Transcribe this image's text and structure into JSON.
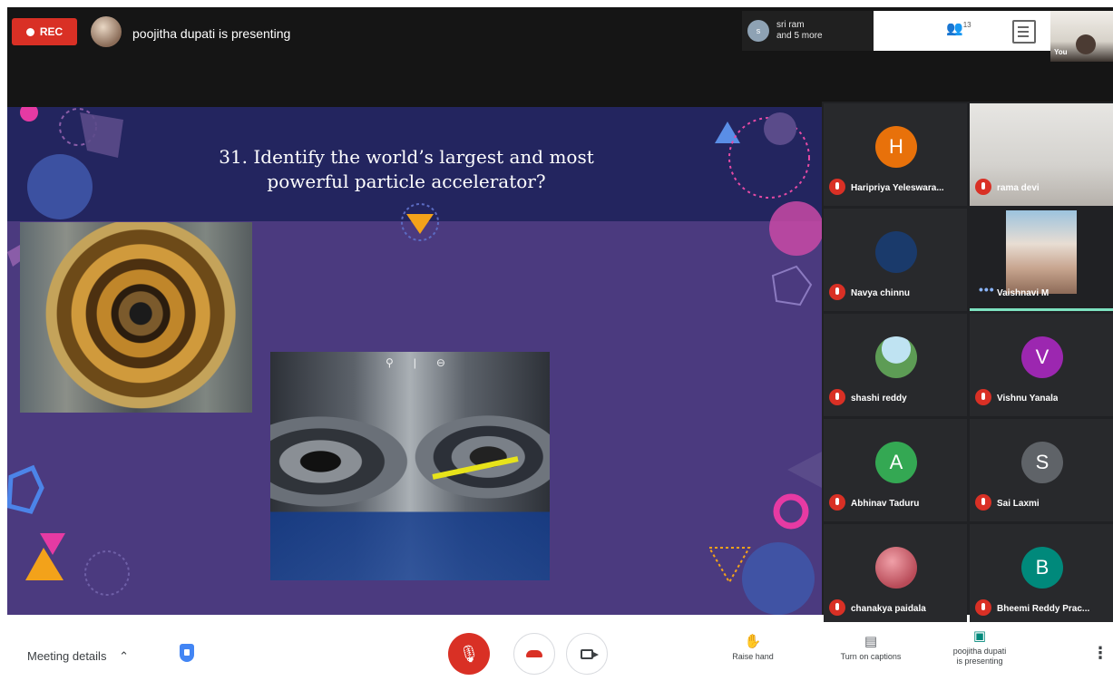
{
  "topbar": {
    "rec_label": "REC",
    "presenting_text": "poojitha dupati is presenting",
    "speaker_initial": "s",
    "speaker_line1": "sri ram",
    "speaker_line2": "and 5 more",
    "people_count": "13",
    "self_label": "You"
  },
  "slide": {
    "question": "31. Identify the world’s largest and most powerful particle accelerator?"
  },
  "participants": [
    {
      "name": "Haripriya Yeleswara...",
      "initial": "H",
      "color": "#e8710a"
    },
    {
      "name": "rama devi",
      "initial": "",
      "color": ""
    },
    {
      "name": "Navya chinnu",
      "initial": "",
      "color": "#1a3a6b"
    },
    {
      "name": "Vaishnavi M",
      "initial": "",
      "color": ""
    },
    {
      "name": "shashi reddy",
      "initial": "",
      "color": "#79b36a"
    },
    {
      "name": "Vishnu Yanala",
      "initial": "V",
      "color": "#9c27b0"
    },
    {
      "name": "Abhinav Taduru",
      "initial": "A",
      "color": "#34a853"
    },
    {
      "name": "Sai Laxmi",
      "initial": "S",
      "color": "#5f6368"
    },
    {
      "name": "chanakya paidala",
      "initial": "",
      "color": "#d36b72"
    },
    {
      "name": "Bheemi Reddy Prac...",
      "initial": "B",
      "color": "#00897b"
    }
  ],
  "bottombar": {
    "meeting_details": "Meeting details",
    "raise_hand": "Raise hand",
    "captions": "Turn on captions",
    "present_line1": "poojitha dupati",
    "present_line2": "is presenting"
  }
}
